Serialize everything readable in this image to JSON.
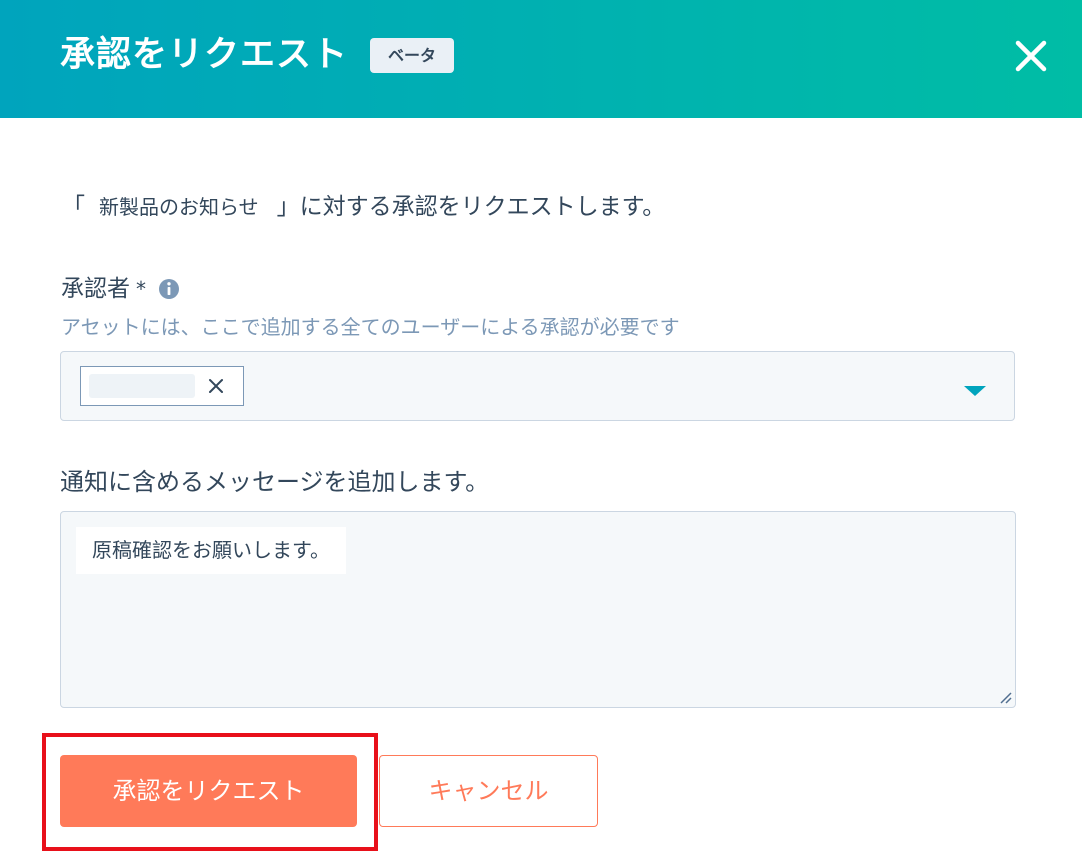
{
  "header": {
    "title": "承認をリクエスト",
    "badge": "ベータ",
    "close_icon": "close-icon"
  },
  "intro": {
    "open_bracket": "「",
    "asset_name": "新製品のお知らせ",
    "text": "」に対する承認をリクエストします。"
  },
  "approvers": {
    "label": "承認者",
    "required_mark": "*",
    "info_icon": "info-icon",
    "help": "アセットには、ここで追加する全てのユーザーによる承認が必要です",
    "remove_icon": "close-icon",
    "dropdown_icon": "caret-down-icon"
  },
  "message": {
    "label": "通知に含めるメッセージを追加します。",
    "value": "原稿確認をお願いします。"
  },
  "footer": {
    "submit_label": "承認をリクエスト",
    "cancel_label": "キャンセル"
  },
  "colors": {
    "header_gradient_start": "#00a4bd",
    "header_gradient_end": "#00bda5",
    "primary": "#ff7a59",
    "text": "#33475b",
    "help_text": "#7c98b6",
    "field_bg": "#f5f8fa",
    "field_border": "#cbd6e2",
    "caret": "#00a4bd",
    "highlight": "#e8101a"
  }
}
